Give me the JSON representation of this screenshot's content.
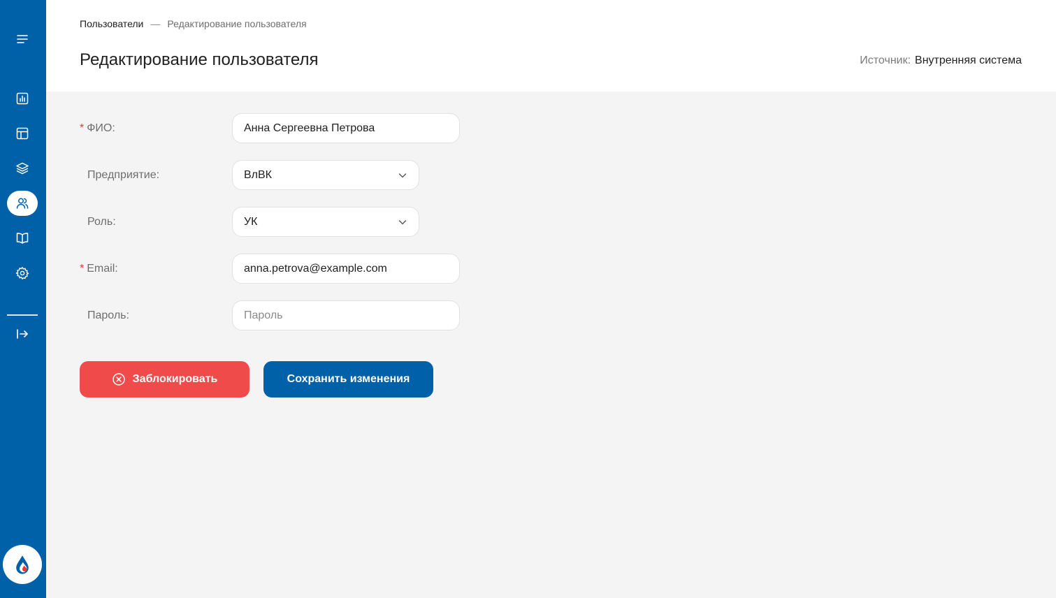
{
  "sidebar": {
    "items": [
      {
        "icon": "menu-icon"
      },
      {
        "icon": "chart-icon"
      },
      {
        "icon": "layout-icon"
      },
      {
        "icon": "layers-icon"
      },
      {
        "icon": "users-icon",
        "active": true
      },
      {
        "icon": "book-icon"
      },
      {
        "icon": "settings-icon"
      },
      {
        "icon": "logout-icon"
      }
    ],
    "accent_color": "#0060a8"
  },
  "header": {
    "breadcrumb": {
      "parent": "Пользователи",
      "separator": "—",
      "current": "Редактирование пользователя"
    },
    "title": "Редактирование пользователя",
    "source_label": "Источник:",
    "source_value": "Внутренняя система"
  },
  "form": {
    "fio": {
      "label": "ФИО:",
      "required": true,
      "value": "Анна Сергеевна Петрова"
    },
    "company": {
      "label": "Предприятие:",
      "value": "ВлВК"
    },
    "role": {
      "label": "Роль:",
      "value": "УК"
    },
    "email": {
      "label": "Email:",
      "required": true,
      "value": "anna.petrova@example.com"
    },
    "password": {
      "label": "Пароль:",
      "value": "",
      "placeholder": "Пароль"
    },
    "required_mark": "*"
  },
  "actions": {
    "block_label": "Заблокировать",
    "save_label": "Сохранить изменения",
    "block_color": "#ef4b4b",
    "save_color": "#0060a8"
  }
}
